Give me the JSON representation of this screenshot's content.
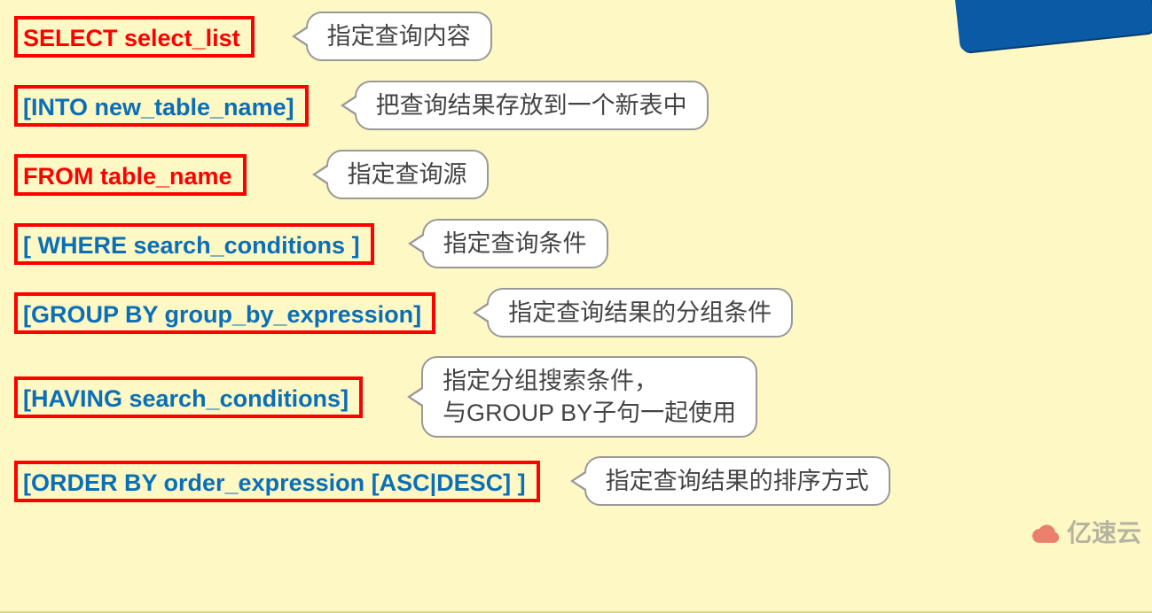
{
  "rows": [
    {
      "sql": "SELECT select_list",
      "color": "red",
      "desc": "指定查询内容",
      "gap": 58
    },
    {
      "sql": "[INTO new_table_name]",
      "color": "blue",
      "desc": "把查询结果存放到一个新表中",
      "gap": 52
    },
    {
      "sql": "FROM table_name",
      "color": "red",
      "desc": "指定查询源",
      "gap": 90
    },
    {
      "sql": "[ WHERE search_conditions ]",
      "color": "blue",
      "desc": "指定查询条件",
      "gap": 54
    },
    {
      "sql": "[GROUP BY group_by_expression]",
      "color": "blue",
      "desc": "指定查询结果的分组条件",
      "gap": 58
    },
    {
      "sql": "[HAVING search_conditions]",
      "color": "blue",
      "desc": "指定分组搜索条件，\n与GROUP BY子句一起使用",
      "gap": 66,
      "tall": true
    },
    {
      "sql": "[ORDER BY order_expression [ASC|DESC] ]",
      "color": "blue",
      "desc": "指定查询结果的排序方式",
      "gap": 50
    }
  ],
  "watermark": "亿速云"
}
